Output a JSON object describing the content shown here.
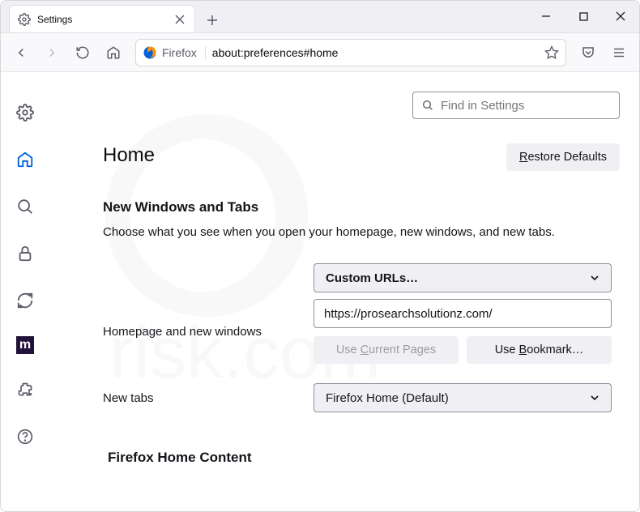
{
  "window": {
    "tab_title": "Settings",
    "identity_label": "Firefox",
    "url": "about:preferences#home"
  },
  "search": {
    "placeholder": "Find in Settings"
  },
  "page": {
    "title": "Home",
    "restore_label": "Restore Defaults",
    "restore_u": "R"
  },
  "section1": {
    "heading": "New Windows and Tabs",
    "desc": "Choose what you see when you open your homepage, new windows, and new tabs.",
    "row1_label": "Homepage and new windows",
    "homepage_select": "Custom URLs…",
    "homepage_url": "https://prosearchsolutionz.com/",
    "use_current": "Use Current Pages",
    "use_current_u": "C",
    "use_bookmark": "Use Bookmark…",
    "use_bookmark_u": "B",
    "row2_label": "New tabs",
    "newtabs_select": "Firefox Home (Default)"
  },
  "section2": {
    "heading": "Firefox Home Content"
  }
}
